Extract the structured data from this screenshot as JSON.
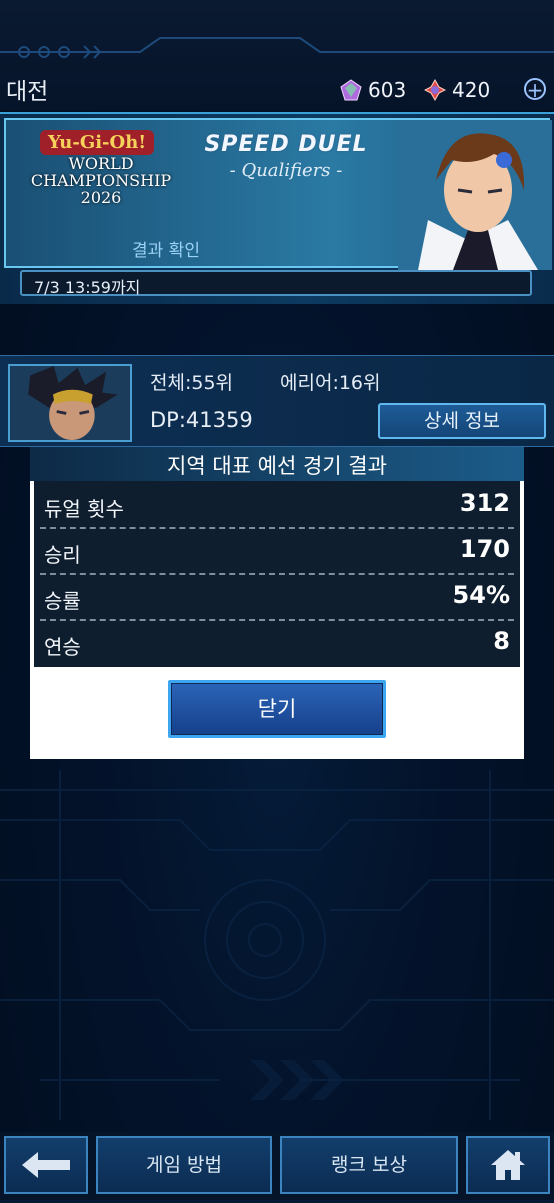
{
  "header": {
    "title": "대전",
    "currencies": [
      {
        "icon": "purple-gem-icon",
        "value": "603"
      },
      {
        "icon": "red-crystal-icon",
        "value": "420"
      }
    ],
    "add_icon": "plus-icon"
  },
  "banner": {
    "logo_line1": "Yu-Gi-Oh!",
    "logo_line2": "WORLD",
    "logo_line3": "CHAMPIONSHIP",
    "logo_line4": "2026",
    "event_title": "SPEED DUEL",
    "event_subtitle": "- Qualifiers -",
    "result_link": "결과 확인",
    "deadline": "7/3 13:59까지"
  },
  "profile": {
    "overall_rank": "전체:55위",
    "area_rank": "에리어:16위",
    "dp": "DP:41359",
    "detail_button": "상세 정보"
  },
  "modal": {
    "title": "지역 대표 예선 경기 결과",
    "rows": [
      {
        "label": "듀얼 횟수",
        "value": "312"
      },
      {
        "label": "승리",
        "value": "170"
      },
      {
        "label": "승률",
        "value": "54%"
      },
      {
        "label": "연승",
        "value": "8"
      }
    ],
    "close_button": "닫기"
  },
  "nav": {
    "back_icon": "back-arrow-icon",
    "how_to_play": "게임 방법",
    "rank_rewards": "랭크 보상",
    "home_icon": "home-icon"
  },
  "colors": {
    "background": "#061833",
    "accent": "#3ea6f0",
    "modal_body": "#0f1e2e"
  }
}
